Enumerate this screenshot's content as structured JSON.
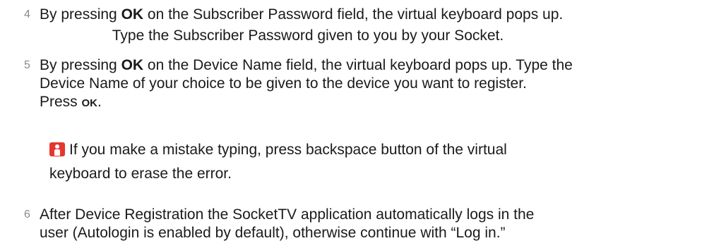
{
  "steps": [
    {
      "number": "4",
      "line1_pre": "By pressing ",
      "line1_bold": "OK",
      "line1_post": " on the Subscriber Password field, the virtual keyboard pops up.",
      "line2": "Type the Subscriber Password given to you by your Socket."
    },
    {
      "number": "5",
      "line1_pre": "By pressing ",
      "line1_bold": "OK",
      "line1_post": " on the Device Name field, the virtual keyboard pops up. Type the",
      "line2": "Device Name of your choice to be given to the device you want to register.",
      "line3_pre": "Press ",
      "line3_bold": "OK",
      "line3_post": "."
    },
    {
      "number": "6",
      "line1": "After Device Registration the SocketTV application automatically logs in the",
      "line2": "user (Autologin is enabled by default), otherwise continue with “Log in.”"
    }
  ],
  "note": {
    "icon": "help-person-icon",
    "icon_color": "#e5372f",
    "line1": "If you make a mistake typing, press backspace button of the virtual",
    "line2": "keyboard to erase the error."
  }
}
